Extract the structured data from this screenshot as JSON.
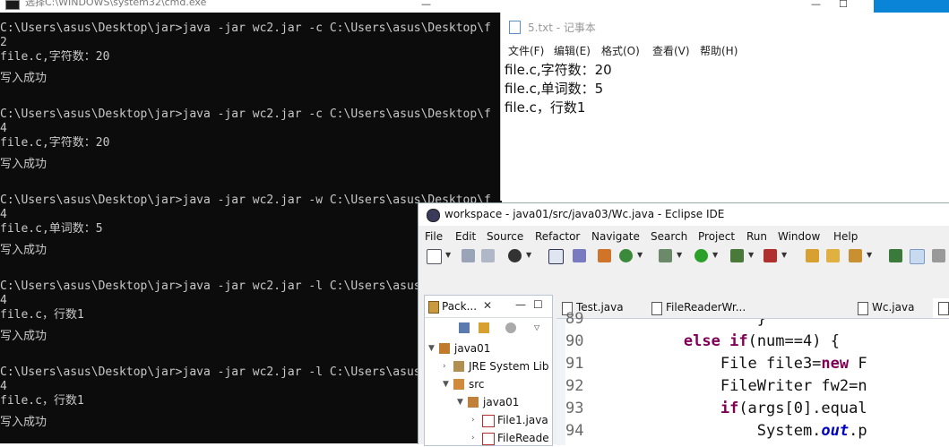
{
  "cmd": {
    "title": "选择C:\\WINDOWS\\system32\\cmd.exe",
    "lines": [
      "C:\\Users\\asus\\Desktop\\jar>java -jar wc2.jar -c C:\\Users\\asus\\Desktop\\f",
      "2",
      "file.c,字符数：20",
      "写入成功",
      "C:\\Users\\asus\\Desktop\\jar>java -jar wc2.jar -c C:\\Users\\asus\\Desktop\\f",
      "4",
      "file.c,字符数：20",
      "写入成功",
      "C:\\Users\\asus\\Desktop\\jar>java -jar wc2.jar -w C:\\Users\\asus\\Desktop\\f",
      "4",
      "file.c,单词数：5",
      "写入成功",
      "C:\\Users\\asus\\Desktop\\jar>java -jar wc2.jar -l C:\\Users\\asus\\Desktop\\f",
      "4",
      "file.c，行数1",
      "写入成功",
      "C:\\Users\\asus\\Desktop\\jar>java -jar wc2.jar -l C:\\Users\\asus\\Desktop\\f",
      "4",
      "file.c，行数1",
      "写入成功"
    ]
  },
  "window_buttons": {
    "minimize": "—",
    "maximize": "☐",
    "close": "✕"
  },
  "notepad": {
    "title": "5.txt - 记事本",
    "menu": [
      "文件(F)",
      "编辑(E)",
      "格式(O)",
      "查看(V)",
      "帮助(H)"
    ],
    "lines": [
      "file.c,字符数：20",
      "file.c,单词数：5",
      "file.c，行数1"
    ]
  },
  "eclipse": {
    "title": "workspace - java01/src/java03/Wc.java - Eclipse IDE",
    "menu": [
      "File",
      "Edit",
      "Source",
      "Refactor",
      "Navigate",
      "Search",
      "Project",
      "Run",
      "Window",
      "Help"
    ],
    "package_explorer": {
      "tab_label": "Pack...",
      "close": "✕",
      "minimize": "—",
      "maximize": "☐",
      "items": [
        {
          "label": "java01"
        },
        {
          "label": "JRE System Lib"
        },
        {
          "label": "src"
        },
        {
          "label": "java01"
        },
        {
          "label": "File1.java"
        },
        {
          "label": "FileReade"
        }
      ]
    },
    "editor_tabs": [
      "Test.java",
      "FileReaderWr...",
      "Wc.java"
    ],
    "line_numbers": [
      "89",
      "90",
      "91",
      "92",
      "93",
      "94"
    ],
    "code": {
      "l89": "                }",
      "l90_kw1": "else",
      "l90_kw2": "if",
      "l90_rest": "(num==4) {",
      "l91_a": "File file3=",
      "l91_kw": "new",
      "l91_b": " F",
      "l92": "FileWriter fw2=n",
      "l93_kw": "if",
      "l93_b": "(args[0].equal",
      "l94_a": "System.",
      "l94_fld": "out",
      "l94_b": ".p"
    }
  }
}
